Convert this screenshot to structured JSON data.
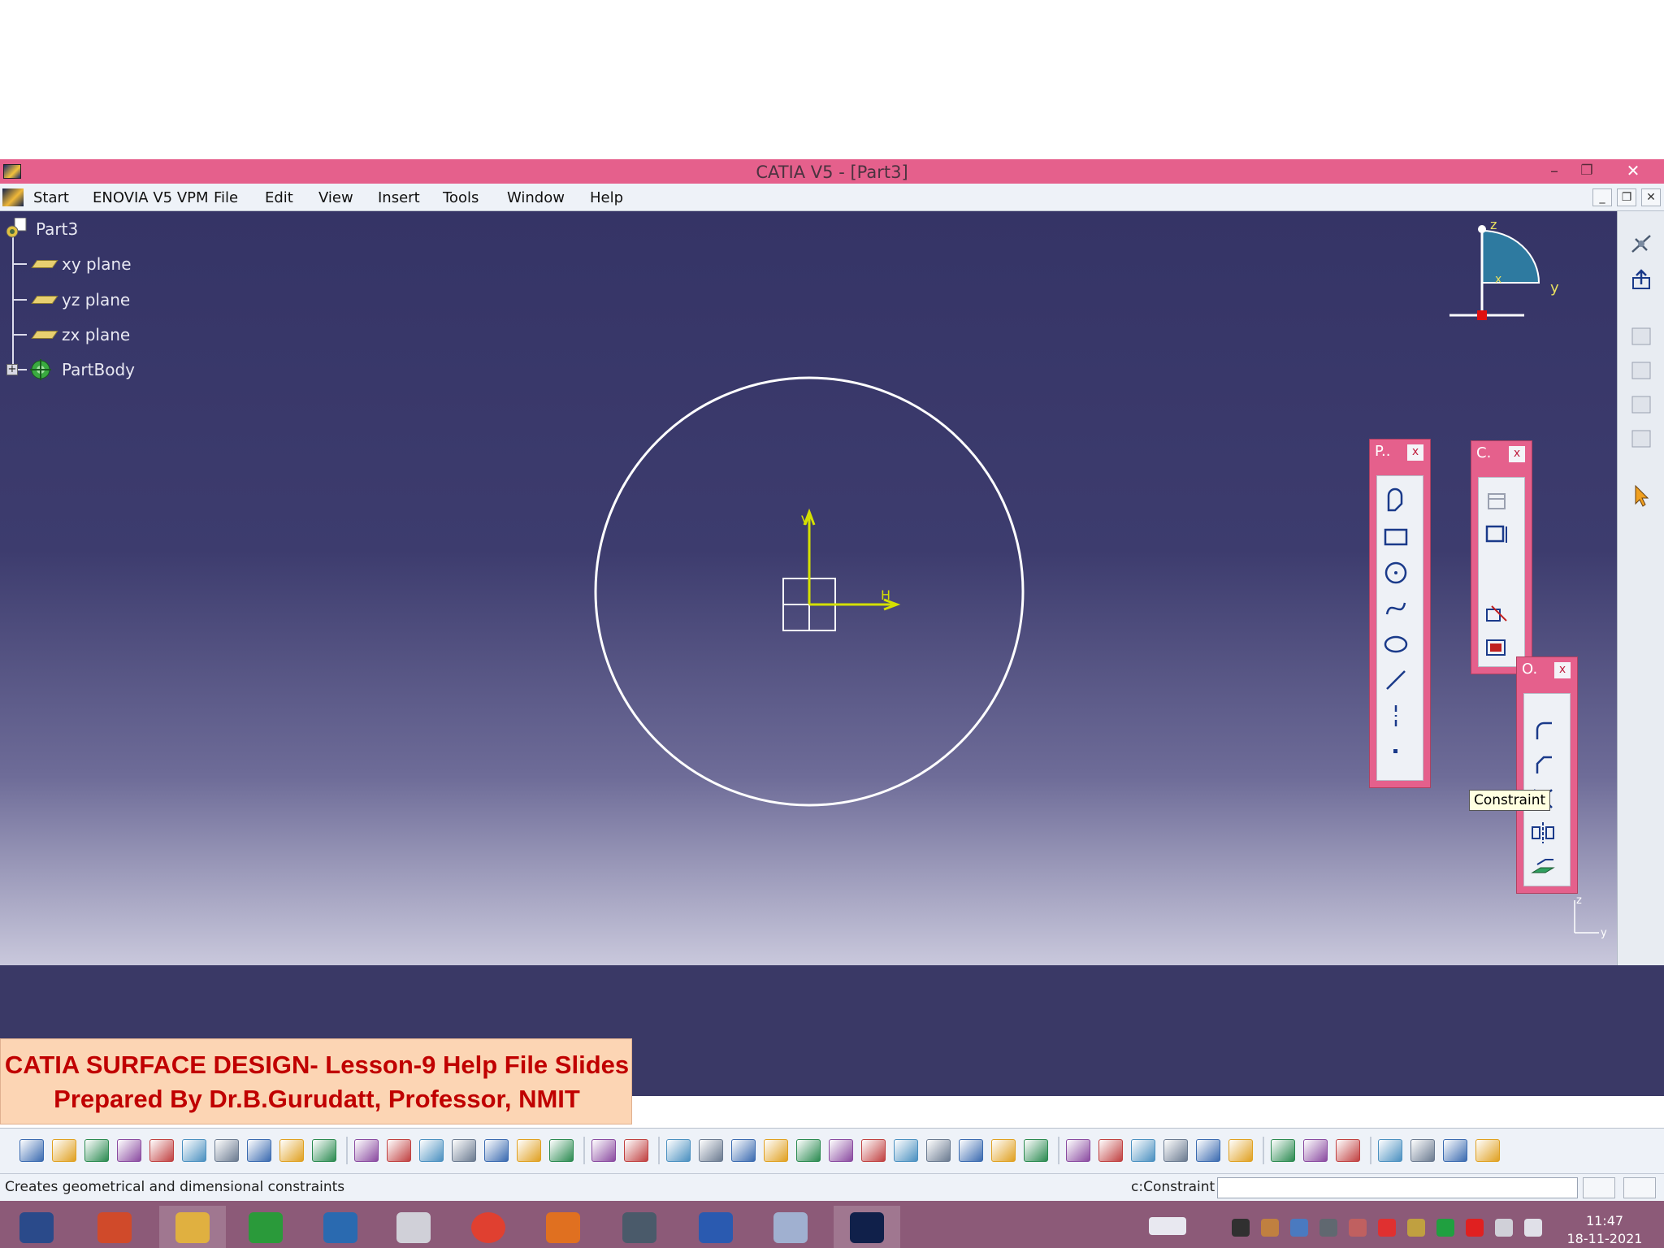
{
  "window": {
    "title": "CATIA V5 - [Part3]",
    "minimize": "–",
    "restore": "❐",
    "close": "✕"
  },
  "menu": {
    "items": [
      "Start",
      "ENOVIA V5 VPM",
      "File",
      "Edit",
      "View",
      "Insert",
      "Tools",
      "Window",
      "Help"
    ],
    "mdi_minimize": "_",
    "mdi_restore": "❐",
    "mdi_close": "✕"
  },
  "tree": {
    "root": "Part3",
    "children": [
      "xy plane",
      "yz plane",
      "zx plane",
      "PartBody"
    ]
  },
  "compass": {
    "z": "z",
    "y": "y",
    "x": "x"
  },
  "sketch_axes": {
    "v": "V",
    "h": "H"
  },
  "palettes": {
    "profile": {
      "title": "P..",
      "close": "x"
    },
    "constraint": {
      "title": "C.",
      "close": "x"
    },
    "operation": {
      "title": "O.",
      "close": "x"
    }
  },
  "tooltip": "Constraint",
  "mini_axis": {
    "z": "z",
    "y": "y"
  },
  "banner": {
    "line1": "CATIA SURFACE DESIGN- Lesson-9  Help File Slides",
    "line2": "Prepared By Dr.B.Gurudatt, Professor, NMIT"
  },
  "status": {
    "message": "Creates geometrical and dimensional constraints",
    "command_label": "c:Constraint",
    "command_value": ""
  },
  "clock": {
    "time": "11:47",
    "date": "18-11-2021"
  },
  "colors": {
    "titlebar": "#e5608c",
    "viewport_top": "#353466",
    "sketch_circle": "#ffffff",
    "sketch_axis": "#d4e000",
    "banner_bg": "#fcd5b4",
    "banner_text": "#c00000",
    "taskbar": "#8c5a78"
  },
  "right_toolbar_icons": [
    "sketch-icon",
    "exit-workbench-icon",
    "catalog-icon",
    "catalog-icon",
    "catalog-icon",
    "catalog-icon",
    "select-arrow-icon"
  ],
  "bottom_toolbar_icons": [
    "new-icon",
    "open-icon",
    "save-icon",
    "print-icon",
    "cut-icon",
    "copy-icon",
    "paste-icon",
    "undo-icon",
    "redo-icon",
    "whats-this-icon",
    "formula-icon",
    "comment-icon",
    "knowledge-icon",
    "table-icon",
    "tree-icon",
    "lock-icon",
    "grid-icon",
    "measure-icon",
    "properties-icon",
    "fly-icon",
    "fit-all-icon",
    "pan-icon",
    "rotate-icon",
    "zoom-in-icon",
    "zoom-out-icon",
    "normal-view-icon",
    "multi-view-icon",
    "isometric-view-icon",
    "render-style-icon",
    "hide-show-icon",
    "swap-visible-icon",
    "sketch-analysis-icon",
    "grid-snap-icon",
    "construction-icon",
    "geometric-constraints-icon",
    "dimensional-constraints-icon",
    "visualization-icon",
    "cut-part-icon",
    "lowlight-icon",
    "pin-icon",
    "transform-1-icon",
    "transform-2-icon",
    "transform-3-icon",
    "catia-logo-icon"
  ],
  "taskbar_apps": [
    "windows-start-icon",
    "powerpoint-icon",
    "file-explorer-icon",
    "store-icon",
    "remote-desktop-icon",
    "snipping-icon",
    "chrome-icon",
    "firefox-icon",
    "solidworks-icon",
    "word-icon",
    "paint-icon",
    "catia-icon"
  ]
}
